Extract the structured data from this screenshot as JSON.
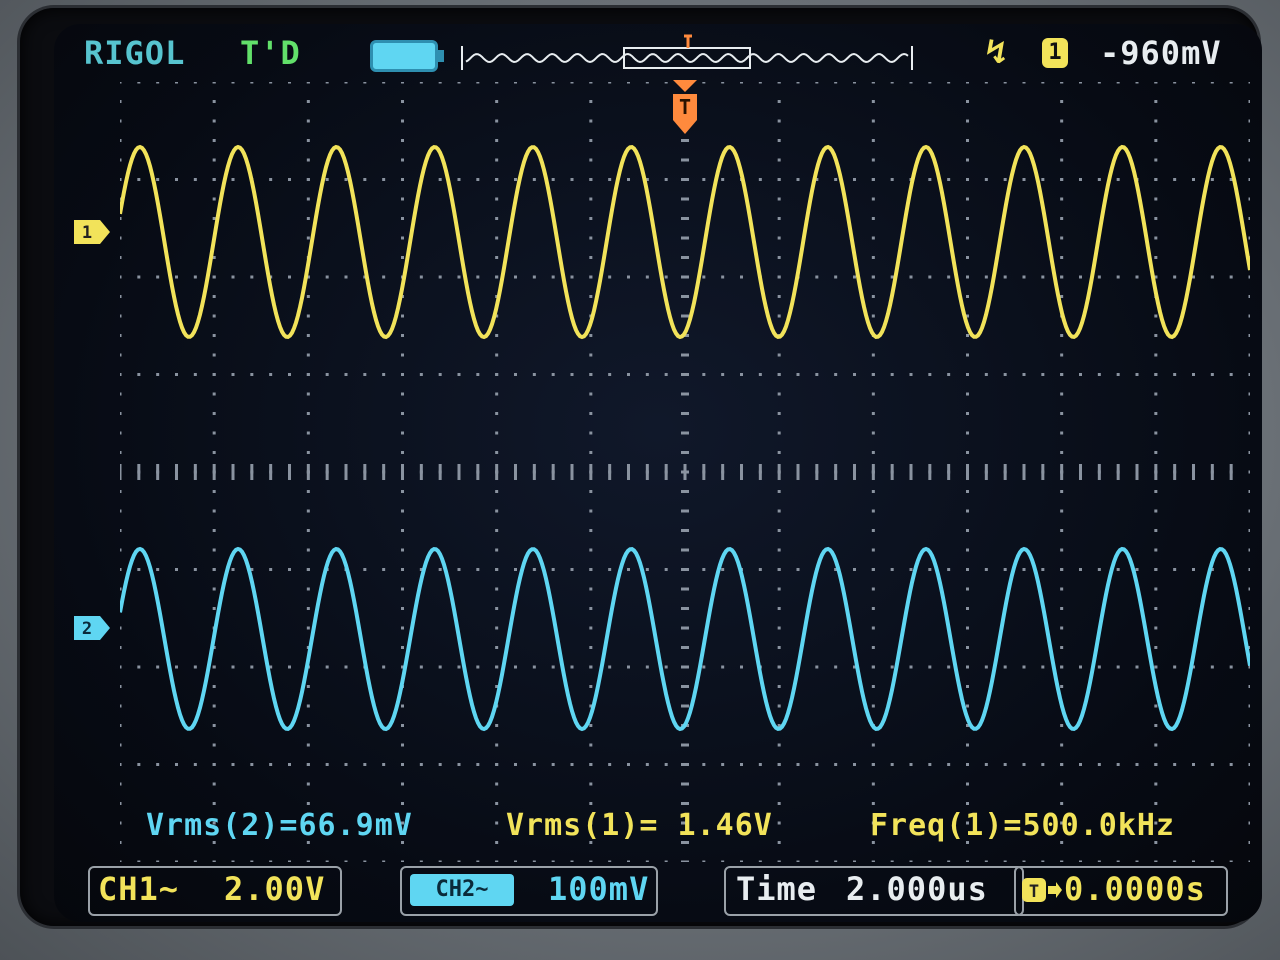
{
  "header": {
    "brand": "RIGOL",
    "run_state": "T'D",
    "battery_icon": "battery-icon",
    "trigger_slope": "↯",
    "trigger_source": "1",
    "trigger_level": "-960mV"
  },
  "channels": {
    "ch1": {
      "marker": "1",
      "color": "#f2e35a"
    },
    "ch2": {
      "marker": "2",
      "color": "#5fd6f2"
    }
  },
  "trigger_marker": "T",
  "measurements": {
    "vrms2": "Vrms(2)=66.9mV",
    "vrms1": "Vrms(1)= 1.46V",
    "freq1": "Freq(1)=500.0kHz"
  },
  "status_bar": {
    "ch1_label": "CH1~",
    "ch1_scale": "2.00V",
    "ch2_label": "CH2~",
    "ch2_scale": "100mV",
    "time_label": "Time",
    "time_scale": "2.000us",
    "trigger_offset_icon": "T",
    "trigger_offset": "0.0000s"
  },
  "chart_data": {
    "type": "line",
    "series": [
      {
        "name": "CH1",
        "waveform": "sine",
        "cycles_on_screen": 11.5,
        "color": "#f2e35a"
      },
      {
        "name": "CH2",
        "waveform": "sine",
        "cycles_on_screen": 11.5,
        "color": "#5fd6f2"
      }
    ],
    "grid": true,
    "divisions": {
      "x": 12,
      "y": 8
    }
  }
}
